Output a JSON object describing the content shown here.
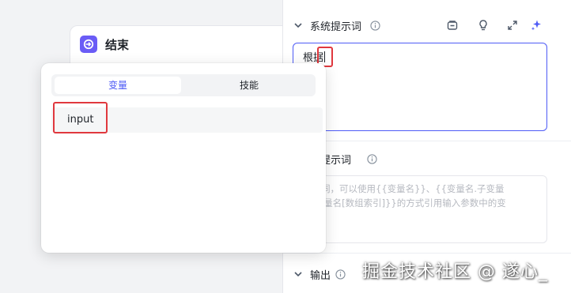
{
  "canvas": {
    "end_node": {
      "title": "结束",
      "accent": "#6a5cf6"
    }
  },
  "panel": {
    "system_prompt": {
      "label": "系统提示词",
      "value": "根据",
      "tools": [
        "template-icon",
        "lightbulb-icon",
        "expand-icon",
        "sparkle-icon"
      ]
    },
    "user_prompt": {
      "label": "用户提示词",
      "label_visible": "户提示词",
      "placeholder_lines": [
        "提示词，可以使用{{变量名}}、{{变量名.子变量",
        "{{变量名[数组索引]}}的方式引用输入参数中的变"
      ]
    },
    "output": {
      "label": "输出"
    }
  },
  "popover": {
    "tabs": [
      {
        "label": "变量",
        "active": true
      },
      {
        "label": "技能",
        "active": false
      }
    ],
    "items": [
      {
        "label": "input"
      }
    ]
  },
  "watermark": "掘金技术社区 @ 遂心_",
  "colors": {
    "accent": "#4e5bf6",
    "highlight": "#e0383e"
  }
}
